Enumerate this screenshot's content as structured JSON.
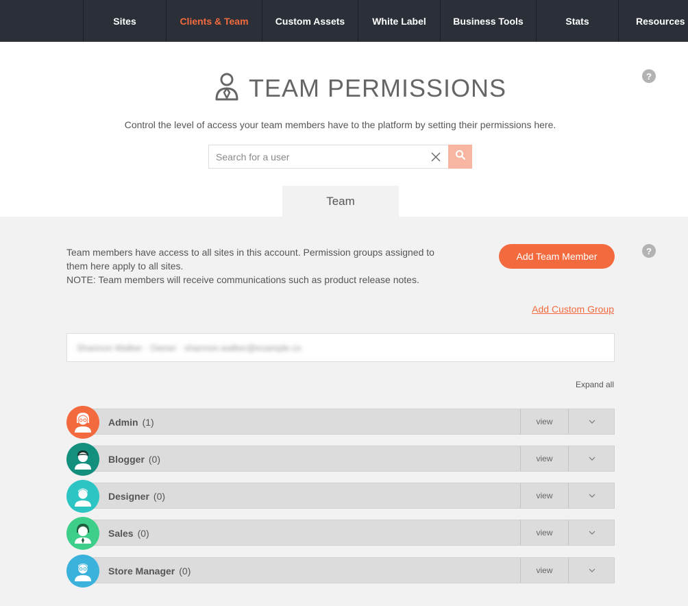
{
  "nav": {
    "items": [
      {
        "label": "Sites"
      },
      {
        "label": "Clients & Team"
      },
      {
        "label": "Custom Assets"
      },
      {
        "label": "White Label"
      },
      {
        "label": "Business Tools"
      },
      {
        "label": "Stats"
      },
      {
        "label": "Resources"
      }
    ],
    "active": "Clients & Team"
  },
  "header": {
    "title": "TEAM PERMISSIONS",
    "subtitle": "Control the level of access your team members have to the platform by setting their permissions here.",
    "help": "?"
  },
  "search": {
    "placeholder": "Search for a user",
    "value": ""
  },
  "tabs": [
    {
      "label": "Team"
    }
  ],
  "team": {
    "description_line1": "Team members have access to all sites in this account. Permission groups assigned to",
    "description_line2": "them here apply to all sites.",
    "description_line3": "NOTE: Team members will receive communications such as product release notes.",
    "add_button": "Add Team Member",
    "custom_group_link": "Add Custom Group",
    "members_placeholder": "Shannon Walker · Owner · shannon.walker@example.co",
    "expand_all": "Expand all",
    "help": "?"
  },
  "groups": [
    {
      "name": "Admin",
      "count": "(1)",
      "view": "view",
      "color": "#f36a3e",
      "icon": "admin-avatar-icon"
    },
    {
      "name": "Blogger",
      "count": "(0)",
      "view": "view",
      "color": "#138f7e",
      "icon": "blogger-avatar-icon"
    },
    {
      "name": "Designer",
      "count": "(0)",
      "view": "view",
      "color": "#2cc5c3",
      "icon": "designer-avatar-icon"
    },
    {
      "name": "Sales",
      "count": "(0)",
      "view": "view",
      "color": "#3dce89",
      "icon": "sales-avatar-icon"
    },
    {
      "name": "Store Manager",
      "count": "(0)",
      "view": "view",
      "color": "#3bb2dc",
      "icon": "store-manager-avatar-icon"
    }
  ]
}
